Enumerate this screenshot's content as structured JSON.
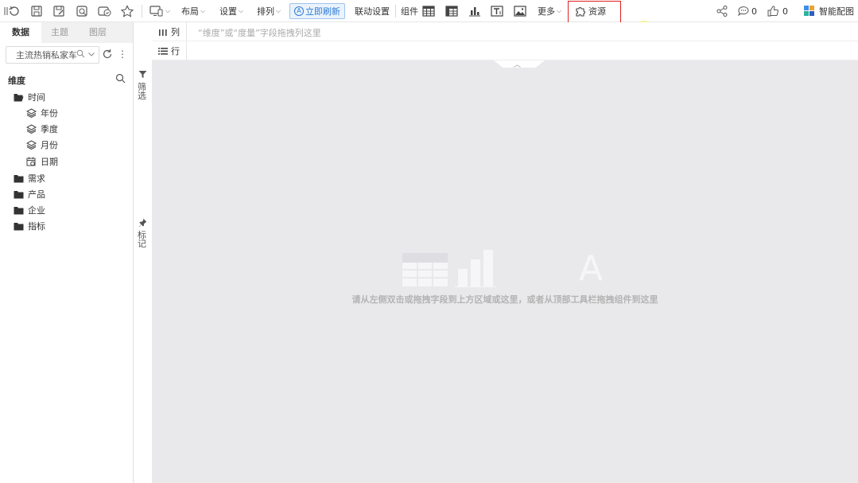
{
  "toolbar": {
    "layout_label": "布局",
    "settings_label": "设置",
    "arrange_label": "排列",
    "refresh_now_label": "立即刷新",
    "linkage_label": "联动设置",
    "components_label": "组件",
    "more_label": "更多",
    "resources_label": "资源",
    "comment_count": "0",
    "like_count": "0",
    "smart_color_label": "智能配图"
  },
  "left_panel": {
    "tabs": [
      "数据",
      "主题",
      "图层"
    ],
    "datasource": "主流热销私家车",
    "section_title": "维度",
    "tree": [
      {
        "label": "时间",
        "icon": "folder-open-icon"
      },
      {
        "label": "年份",
        "icon": "layers-icon"
      },
      {
        "label": "季度",
        "icon": "layers-icon"
      },
      {
        "label": "月份",
        "icon": "layers-icon"
      },
      {
        "label": "日期",
        "icon": "calendar-icon"
      },
      {
        "label": "需求",
        "icon": "folder-icon"
      },
      {
        "label": "产品",
        "icon": "folder-icon"
      },
      {
        "label": "企业",
        "icon": "folder-icon"
      },
      {
        "label": "指标",
        "icon": "folder-icon"
      }
    ]
  },
  "side_strip": {
    "filter_label": "筛选",
    "mark_label": "标记"
  },
  "shelves": {
    "columns_label": "列",
    "columns_hint": "“维度”或“度量”字段拖拽列这里",
    "rows_label": "行"
  },
  "canvas": {
    "placeholder_text": "请从左侧双击或拖拽字段到上方区域或这里，或者从顶部工具栏拖拽组件到这里"
  },
  "colors": {
    "accent": "#2f7bd5",
    "highlight_border": "#e02020",
    "canvas_bg": "#e9e9ec"
  }
}
